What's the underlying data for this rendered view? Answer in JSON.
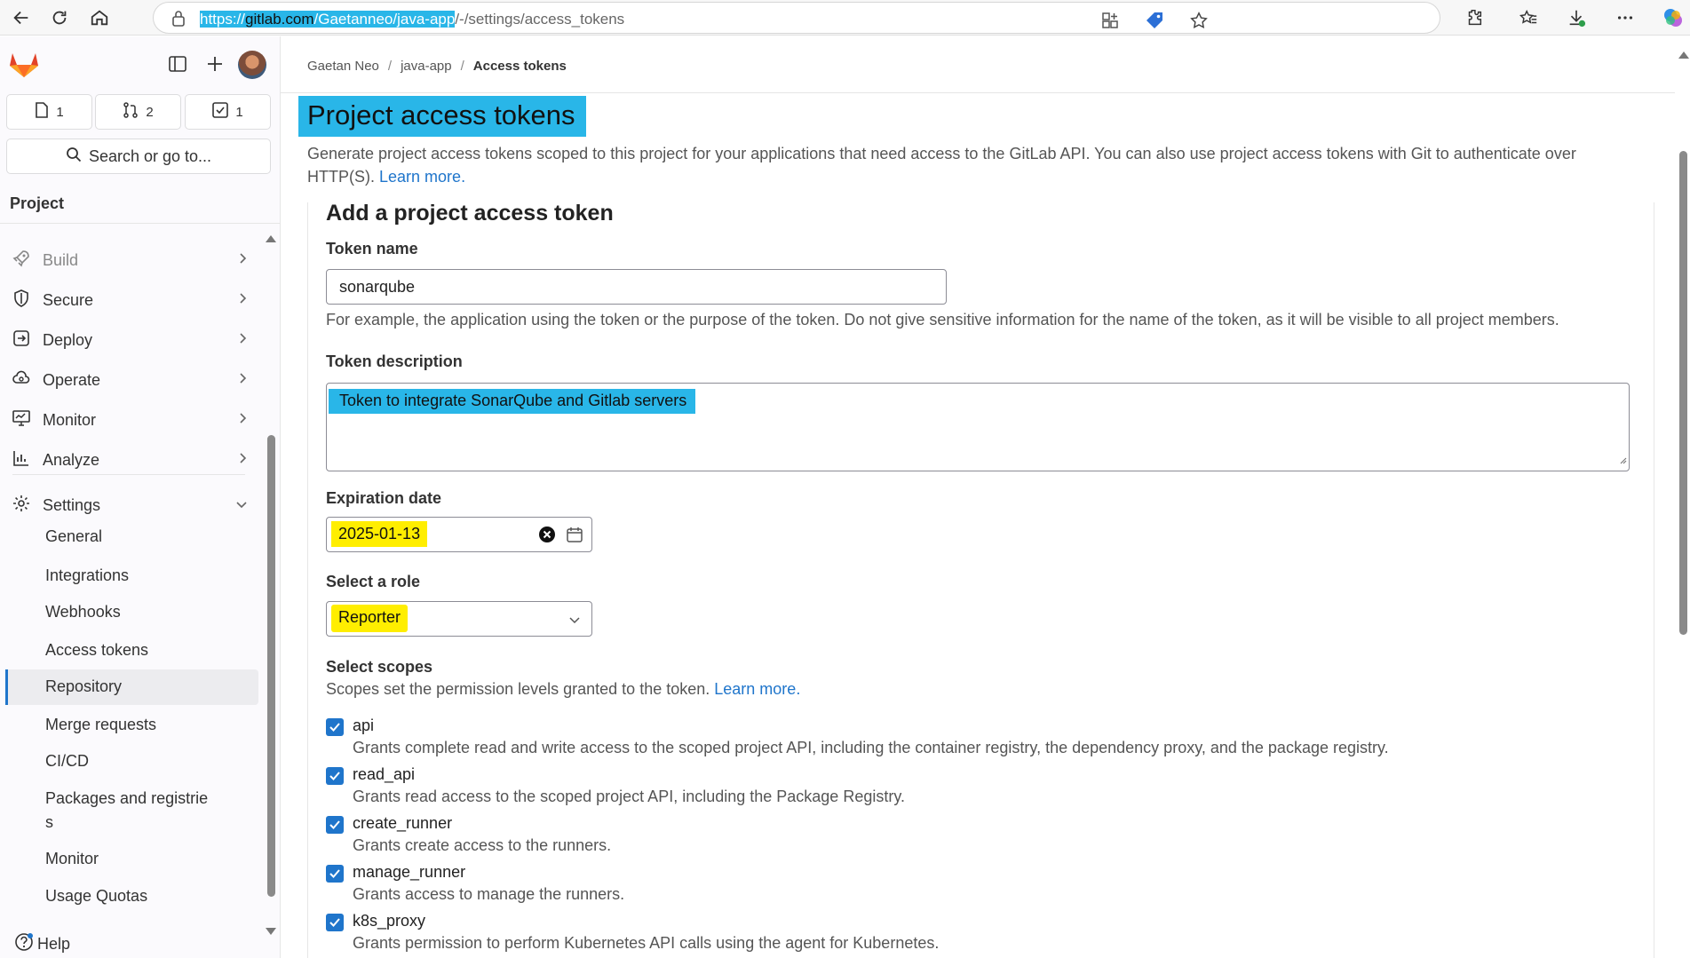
{
  "browser": {
    "url_prefix": "https://gitlab.com/Gaetanneo/java-app",
    "url_scheme": "https://",
    "url_domain": "gitlab.com",
    "url_path_hl": "/Gaetanneo/java-app",
    "url_rest": "/-/settings/access_tokens"
  },
  "sidebar": {
    "counters": [
      {
        "icon": "issues-icon",
        "count": "1"
      },
      {
        "icon": "merge-request-icon",
        "count": "2"
      },
      {
        "icon": "todo-icon",
        "count": "1"
      }
    ],
    "search_label": "Search or go to...",
    "section_title": "Project",
    "nav": [
      {
        "label": "Build",
        "icon": "rocket-icon"
      },
      {
        "label": "Secure",
        "icon": "shield-icon"
      },
      {
        "label": "Deploy",
        "icon": "deploy-icon"
      },
      {
        "label": "Operate",
        "icon": "cloud-gear-icon"
      },
      {
        "label": "Monitor",
        "icon": "monitor-icon"
      },
      {
        "label": "Analyze",
        "icon": "chart-icon"
      },
      {
        "label": "Settings",
        "icon": "gear-icon"
      }
    ],
    "settings_items": [
      "General",
      "Integrations",
      "Webhooks",
      "Access tokens",
      "Repository",
      "Merge requests",
      "CI/CD",
      "Packages and registrie",
      "s",
      "Monitor",
      "Usage Quotas"
    ],
    "help_label": "Help"
  },
  "breadcrumb": {
    "items": [
      "Gaetan Neo",
      "java-app",
      "Access tokens"
    ]
  },
  "page": {
    "title": "Project access tokens",
    "description": "Generate project access tokens scoped to this project for your applications that need access to the GitLab API. You can also use project access tokens with Git to authenticate over HTTP(S).",
    "learn_more": "Learn more."
  },
  "form": {
    "title": "Add a project access token",
    "token_name_label": "Token name",
    "token_name_value": "sonarqube",
    "token_name_help": "For example, the application using the token or the purpose of the token. Do not give sensitive information for the name of the token, as it will be visible to all project members.",
    "desc_label": "Token description",
    "desc_value": "Token to integrate SonarQube and Gitlab servers",
    "exp_label": "Expiration date",
    "exp_value": "2025-01-13",
    "role_label": "Select a role",
    "role_value": "Reporter",
    "scopes_label": "Select scopes",
    "scopes_help": "Scopes set the permission levels granted to the token.",
    "scopes_learn_more": "Learn more.",
    "scopes": [
      {
        "name": "api",
        "desc": "Grants complete read and write access to the scoped project API, including the container registry, the dependency proxy, and the package registry.",
        "checked": true
      },
      {
        "name": "read_api",
        "desc": "Grants read access to the scoped project API, including the Package Registry.",
        "checked": true
      },
      {
        "name": "create_runner",
        "desc": "Grants create access to the runners.",
        "checked": true
      },
      {
        "name": "manage_runner",
        "desc": "Grants access to manage the runners.",
        "checked": true
      },
      {
        "name": "k8s_proxy",
        "desc": "Grants permission to perform Kubernetes API calls using the agent for Kubernetes.",
        "checked": true
      }
    ]
  },
  "colors": {
    "accent": "#1f75cb",
    "highlight_blue": "#29b6e8",
    "highlight_yellow": "#ffee00"
  }
}
